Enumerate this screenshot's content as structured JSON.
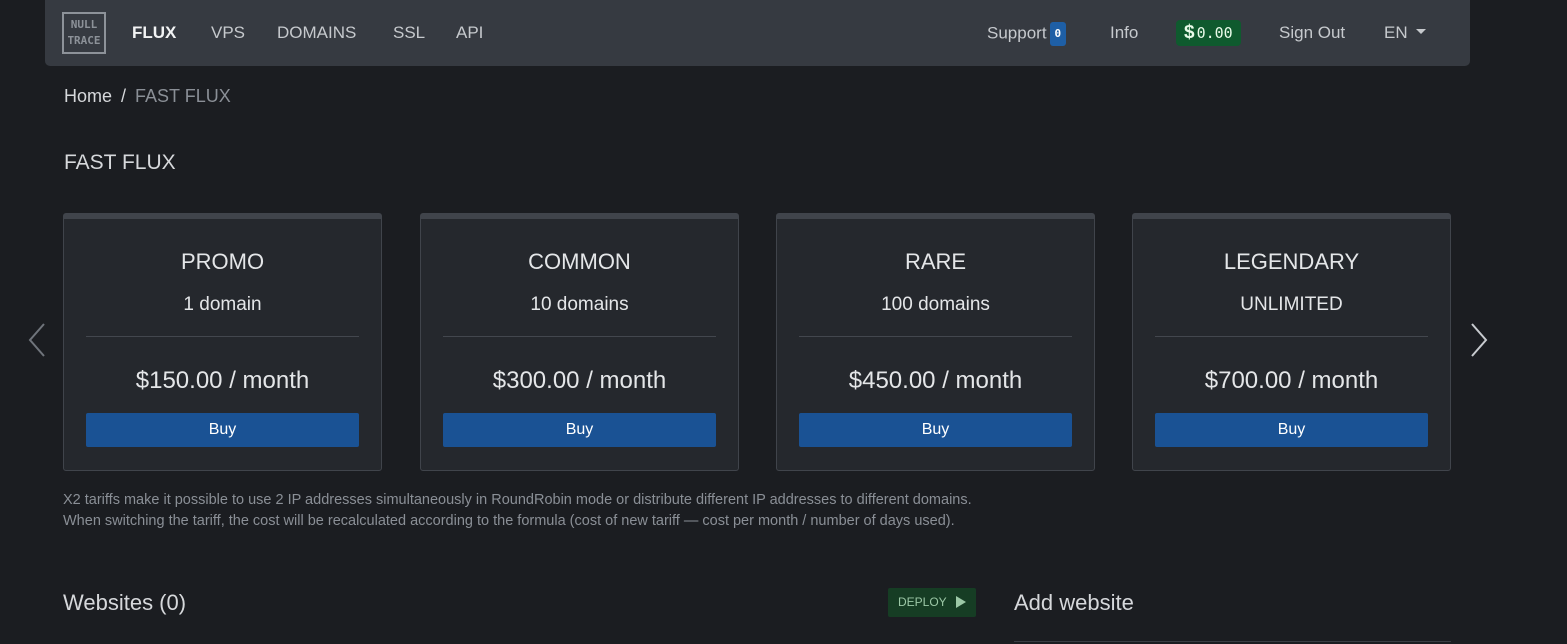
{
  "navbar": {
    "logo_line1": "NULL",
    "logo_line2": "TRACE",
    "items": [
      {
        "label": "FLUX",
        "active": true
      },
      {
        "label": "VPS"
      },
      {
        "label": "DOMAINS"
      },
      {
        "label": "SSL"
      },
      {
        "label": "API"
      }
    ],
    "support_label": "Support",
    "support_count": "0",
    "info_label": "Info",
    "balance_symbol": "$",
    "balance_amount": "0.00",
    "signout_label": "Sign Out",
    "language": "EN"
  },
  "breadcrumb": {
    "home": "Home",
    "separator": "/",
    "current": "FAST FLUX"
  },
  "page_title": "FAST FLUX",
  "plans": [
    {
      "name": "PROMO",
      "domains": "1 domain",
      "price": "$150.00 / month",
      "button": "Buy"
    },
    {
      "name": "COMMON",
      "domains": "10 domains",
      "price": "$300.00 / month",
      "button": "Buy"
    },
    {
      "name": "RARE",
      "domains": "100 domains",
      "price": "$450.00 / month",
      "button": "Buy"
    },
    {
      "name": "LEGENDARY",
      "domains": "UNLIMITED",
      "price": "$700.00 / month",
      "button": "Buy"
    }
  ],
  "notes": {
    "line1": "X2 tariffs make it possible to use 2 IP addresses simultaneously in RoundRobin mode or distribute different IP addresses to different domains.",
    "line2": "When switching the tariff, the cost will be recalculated according to the formula (cost of new tariff — cost per month / number of days used)."
  },
  "websites": {
    "title": "Websites (0)",
    "deploy_label": "DEPLOY"
  },
  "add_website": {
    "title": "Add website"
  },
  "icons": {
    "carousel_prev": "chevron-left-icon",
    "carousel_next": "chevron-right-icon",
    "language_caret": "caret-down-icon",
    "deploy_play": "play-icon"
  },
  "colors": {
    "background": "#1b1d21",
    "navbar": "#363a41",
    "card": "#25282d",
    "buy_button": "#1a5294",
    "balance_badge": "#0f5a2e",
    "support_badge": "#1e5fa6",
    "deploy_button": "#163d24"
  }
}
